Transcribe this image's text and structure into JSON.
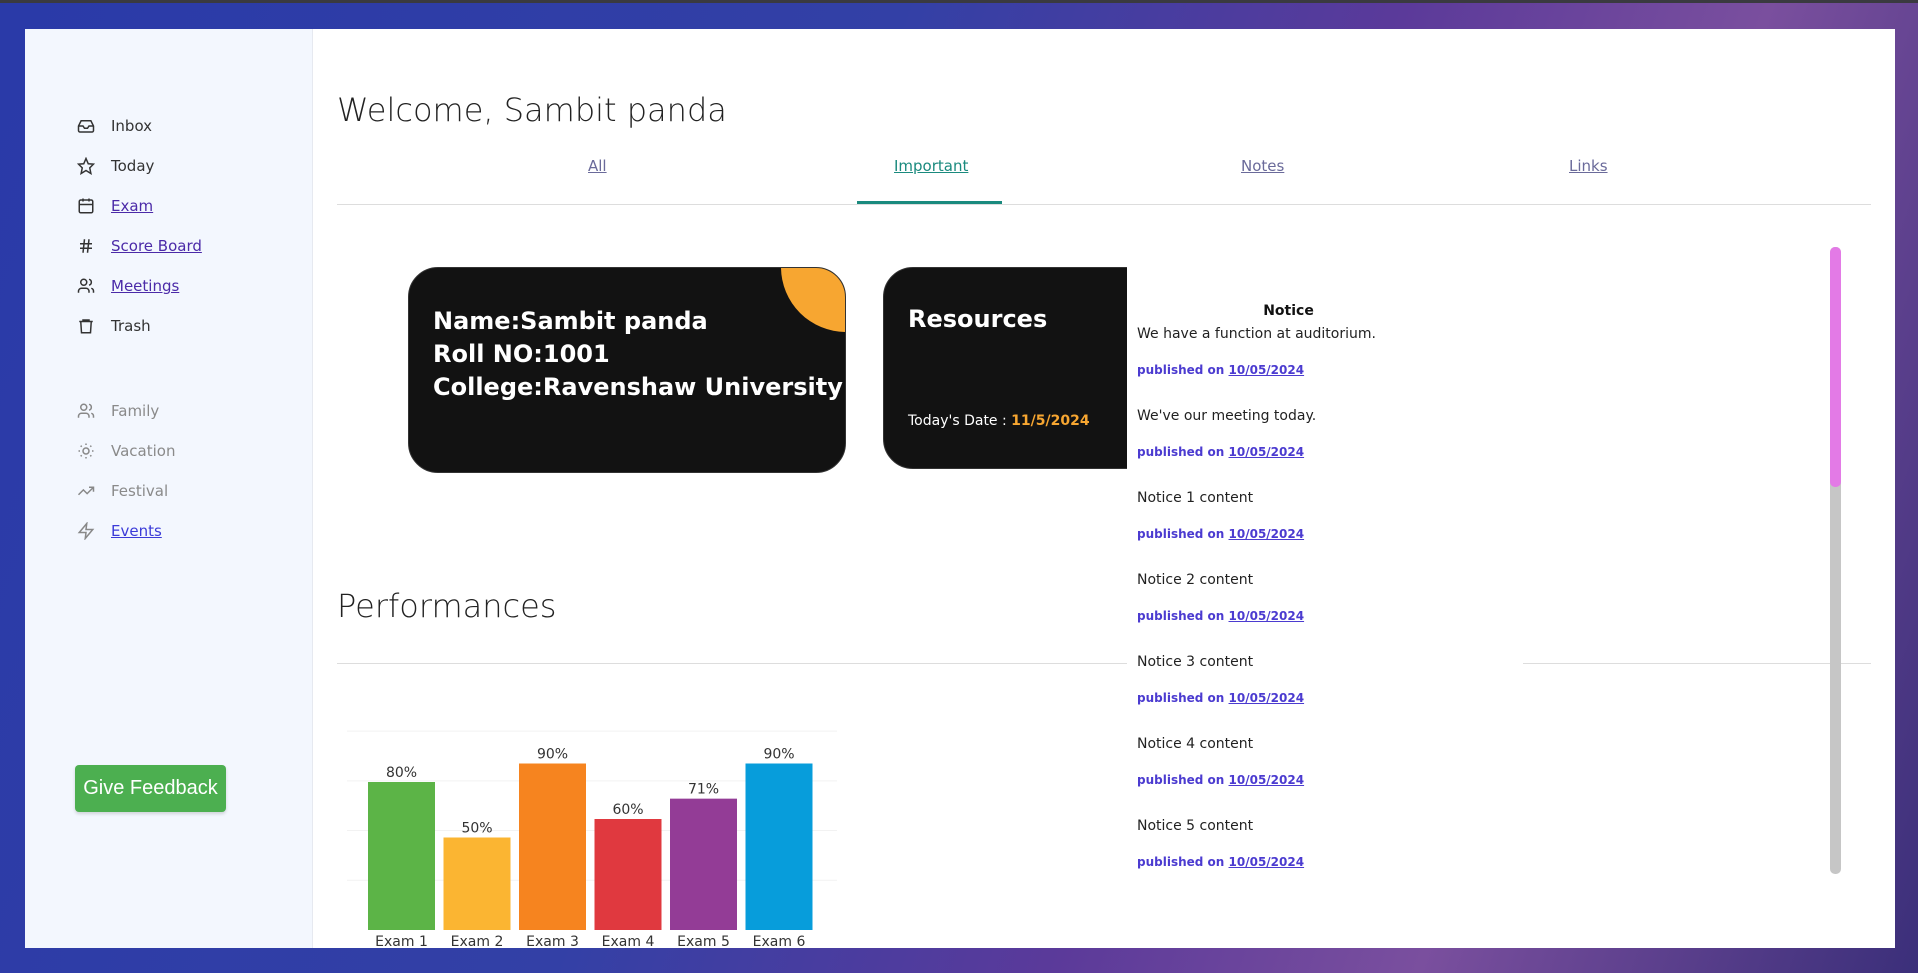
{
  "sidebar": {
    "primary": [
      {
        "label": "Inbox",
        "icon": "inbox-icon",
        "link": false
      },
      {
        "label": "Today",
        "icon": "star-icon",
        "link": false
      },
      {
        "label": "Exam",
        "icon": "calendar-icon",
        "link": true
      },
      {
        "label": "Score Board",
        "icon": "hash-icon",
        "link": true
      },
      {
        "label": "Meetings",
        "icon": "users-icon",
        "link": true
      },
      {
        "label": "Trash",
        "icon": "trash-icon",
        "link": false
      }
    ],
    "secondary": [
      {
        "label": "Family",
        "icon": "users-icon",
        "link": false
      },
      {
        "label": "Vacation",
        "icon": "sun-icon",
        "link": false
      },
      {
        "label": "Festival",
        "icon": "trending-up-icon",
        "link": false
      },
      {
        "label": "Events",
        "icon": "zap-icon",
        "link": true
      }
    ],
    "feedback_label": "Give Feedback"
  },
  "header": {
    "welcome": "Welcome, Sambit panda"
  },
  "tabs": [
    "All",
    "Important",
    "Notes",
    "Links"
  ],
  "active_tab": "Important",
  "info_card": {
    "name": "Name:Sambit panda",
    "roll": "Roll NO:1001",
    "college": "College:Ravenshaw University",
    "corner_color": "#f7a631"
  },
  "resources_card": {
    "title": "Resources",
    "date_label": "Today's Date : ",
    "date_value": "11/5/2024",
    "corner_color": "#3ecf5e"
  },
  "performance": {
    "heading": "Performances"
  },
  "chart_data": {
    "type": "bar",
    "categories": [
      "Exam 1",
      "Exam 2",
      "Exam 3",
      "Exam 4",
      "Exam 5",
      "Exam 6"
    ],
    "values": [
      80,
      50,
      90,
      60,
      71,
      90
    ],
    "labels": [
      "80%",
      "50%",
      "90%",
      "60%",
      "71%",
      "90%"
    ],
    "colors": [
      "#5cb447",
      "#fbb532",
      "#f6841f",
      "#e0393f",
      "#933c96",
      "#079ddb"
    ],
    "ylim": [
      0,
      100
    ]
  },
  "notice": {
    "title": "Notice",
    "items": [
      {
        "text": "We have a function at auditorium.",
        "published": "published on ",
        "date": "10/05/2024"
      },
      {
        "text": "We've our meeting today.",
        "published": "published on ",
        "date": "10/05/2024"
      },
      {
        "text": "Notice 1 content",
        "published": "published on ",
        "date": "10/05/2024"
      },
      {
        "text": "Notice 2 content",
        "published": "published on ",
        "date": "10/05/2024"
      },
      {
        "text": "Notice 3 content",
        "published": "published on ",
        "date": "10/05/2024"
      },
      {
        "text": "Notice 4 content",
        "published": "published on ",
        "date": "10/05/2024"
      },
      {
        "text": "Notice 5 content",
        "published": "published on ",
        "date": "10/05/2024"
      }
    ]
  },
  "colors": {
    "accent": "#1a8a7e",
    "feedback": "#4caf50",
    "scroll_thumb": "#e37ae6"
  }
}
